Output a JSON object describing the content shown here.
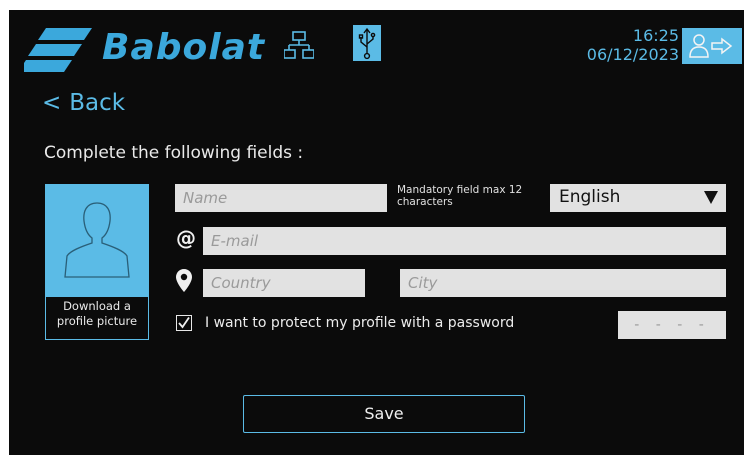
{
  "header": {
    "brand": "Babolat",
    "time": "16:25",
    "date": "06/12/2023",
    "accent_color": "#5bbbe6",
    "icons": [
      "babolat-logo",
      "network-icon",
      "usb-icon",
      "logout-icon"
    ]
  },
  "nav": {
    "back_label": "Back"
  },
  "form": {
    "instructions": "Complete the following fields :",
    "avatar_label_line1": "Download a",
    "avatar_label_line2": "profile picture",
    "name_placeholder": "Name",
    "name_hint": "Mandatory field max 12 characters",
    "language_value": "English",
    "email_placeholder": "E-mail",
    "email_icon": "@",
    "country_placeholder": "Country",
    "city_placeholder": "City",
    "password_checkbox_label": "I want to protect my profile with a password",
    "password_checked": true,
    "password_mask": "----",
    "save_label": "Save"
  }
}
